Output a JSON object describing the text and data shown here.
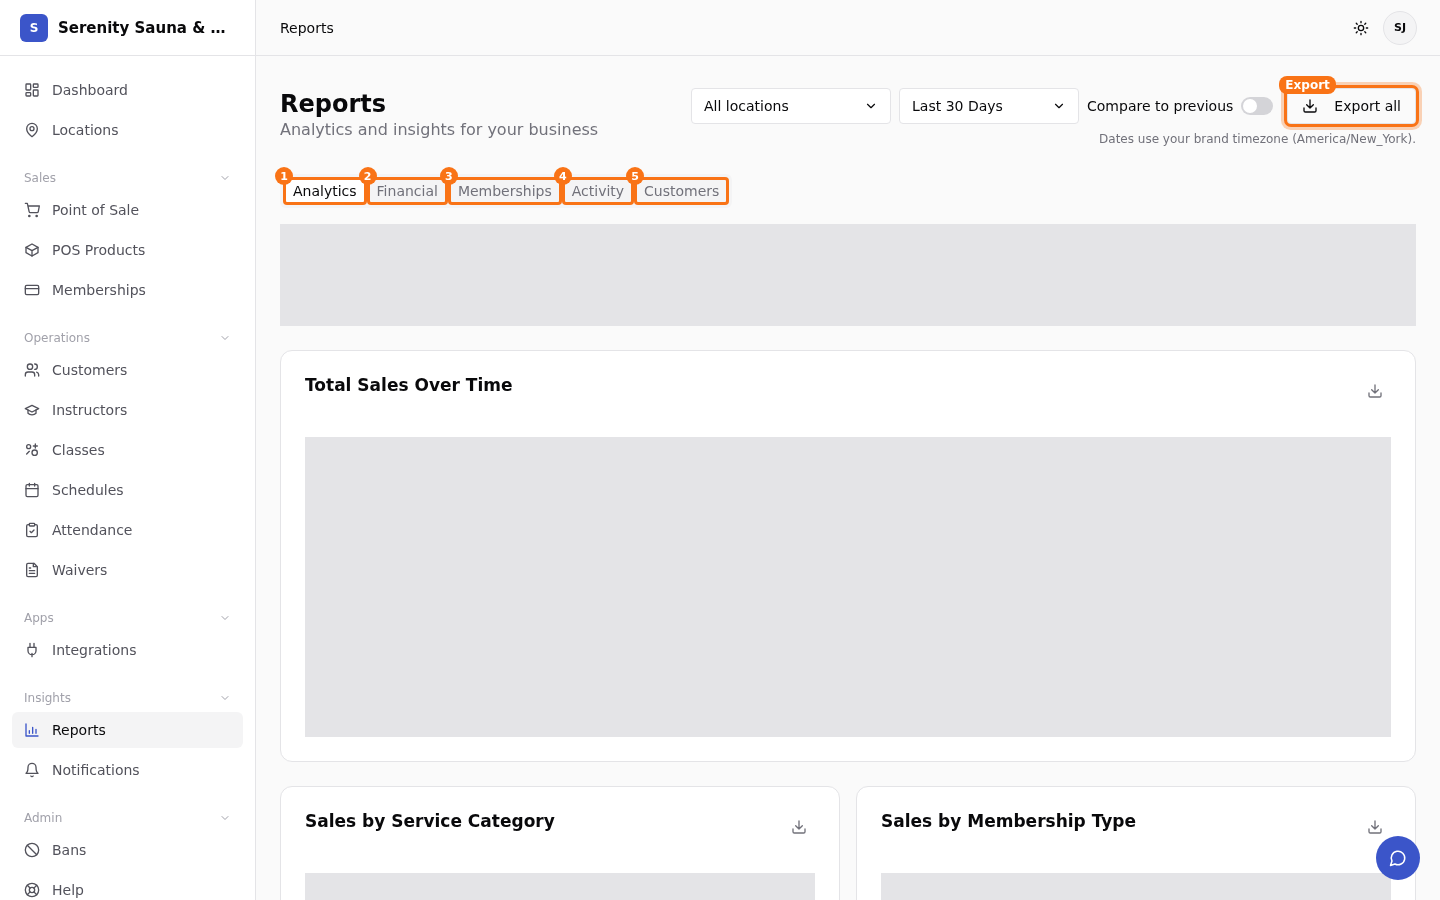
{
  "sidebar": {
    "logo_letter": "S",
    "brand": "Serenity Sauna & …",
    "groups": [
      {
        "items": [
          {
            "label": "Dashboard",
            "selected": false
          },
          {
            "label": "Locations",
            "selected": false
          }
        ]
      },
      {
        "title": "Sales",
        "expanded": true,
        "items": [
          {
            "label": "Point of Sale",
            "selected": false
          },
          {
            "label": "POS Products",
            "selected": false
          },
          {
            "label": "Memberships",
            "selected": false
          }
        ]
      },
      {
        "title": "Operations",
        "expanded": true,
        "items": [
          {
            "label": "Customers",
            "selected": false
          },
          {
            "label": "Instructors",
            "selected": false
          },
          {
            "label": "Classes",
            "selected": false
          },
          {
            "label": "Schedules",
            "selected": false
          },
          {
            "label": "Attendance",
            "selected": false
          },
          {
            "label": "Waivers",
            "selected": false
          }
        ]
      },
      {
        "title": "Apps",
        "expanded": true,
        "items": [
          {
            "label": "Integrations",
            "selected": false
          }
        ]
      },
      {
        "title": "Insights",
        "expanded": true,
        "items": [
          {
            "label": "Reports",
            "selected": true
          },
          {
            "label": "Notifications",
            "selected": false
          }
        ]
      },
      {
        "title": "Admin",
        "expanded": true,
        "items": [
          {
            "label": "Bans",
            "selected": false
          },
          {
            "label": "Help",
            "selected": false
          }
        ]
      }
    ]
  },
  "topbar": {
    "breadcrumb": "Reports",
    "avatar": "SJ"
  },
  "page": {
    "title": "Reports",
    "subtitle": "Analytics and insights for your business",
    "location_select": "All locations",
    "range_select": "Last 30 Days",
    "compare": {
      "label": "Compare to previous",
      "on": false
    },
    "export_button": {
      "label": "Export all",
      "marker": "Export"
    },
    "timezone_note": "Dates use your brand timezone (America/New_York).",
    "tabs": [
      {
        "label": "Analytics",
        "selected": true,
        "marker": "1"
      },
      {
        "label": "Financial",
        "selected": false,
        "marker": "2"
      },
      {
        "label": "Memberships",
        "selected": false,
        "marker": "3"
      },
      {
        "label": "Activity",
        "selected": false,
        "marker": "4"
      },
      {
        "label": "Customers",
        "selected": false,
        "marker": "5"
      }
    ],
    "cards": [
      {
        "title": "Total Sales Over Time"
      },
      {
        "title": "Sales by Service Category"
      },
      {
        "title": "Sales by Membership Type"
      }
    ]
  }
}
